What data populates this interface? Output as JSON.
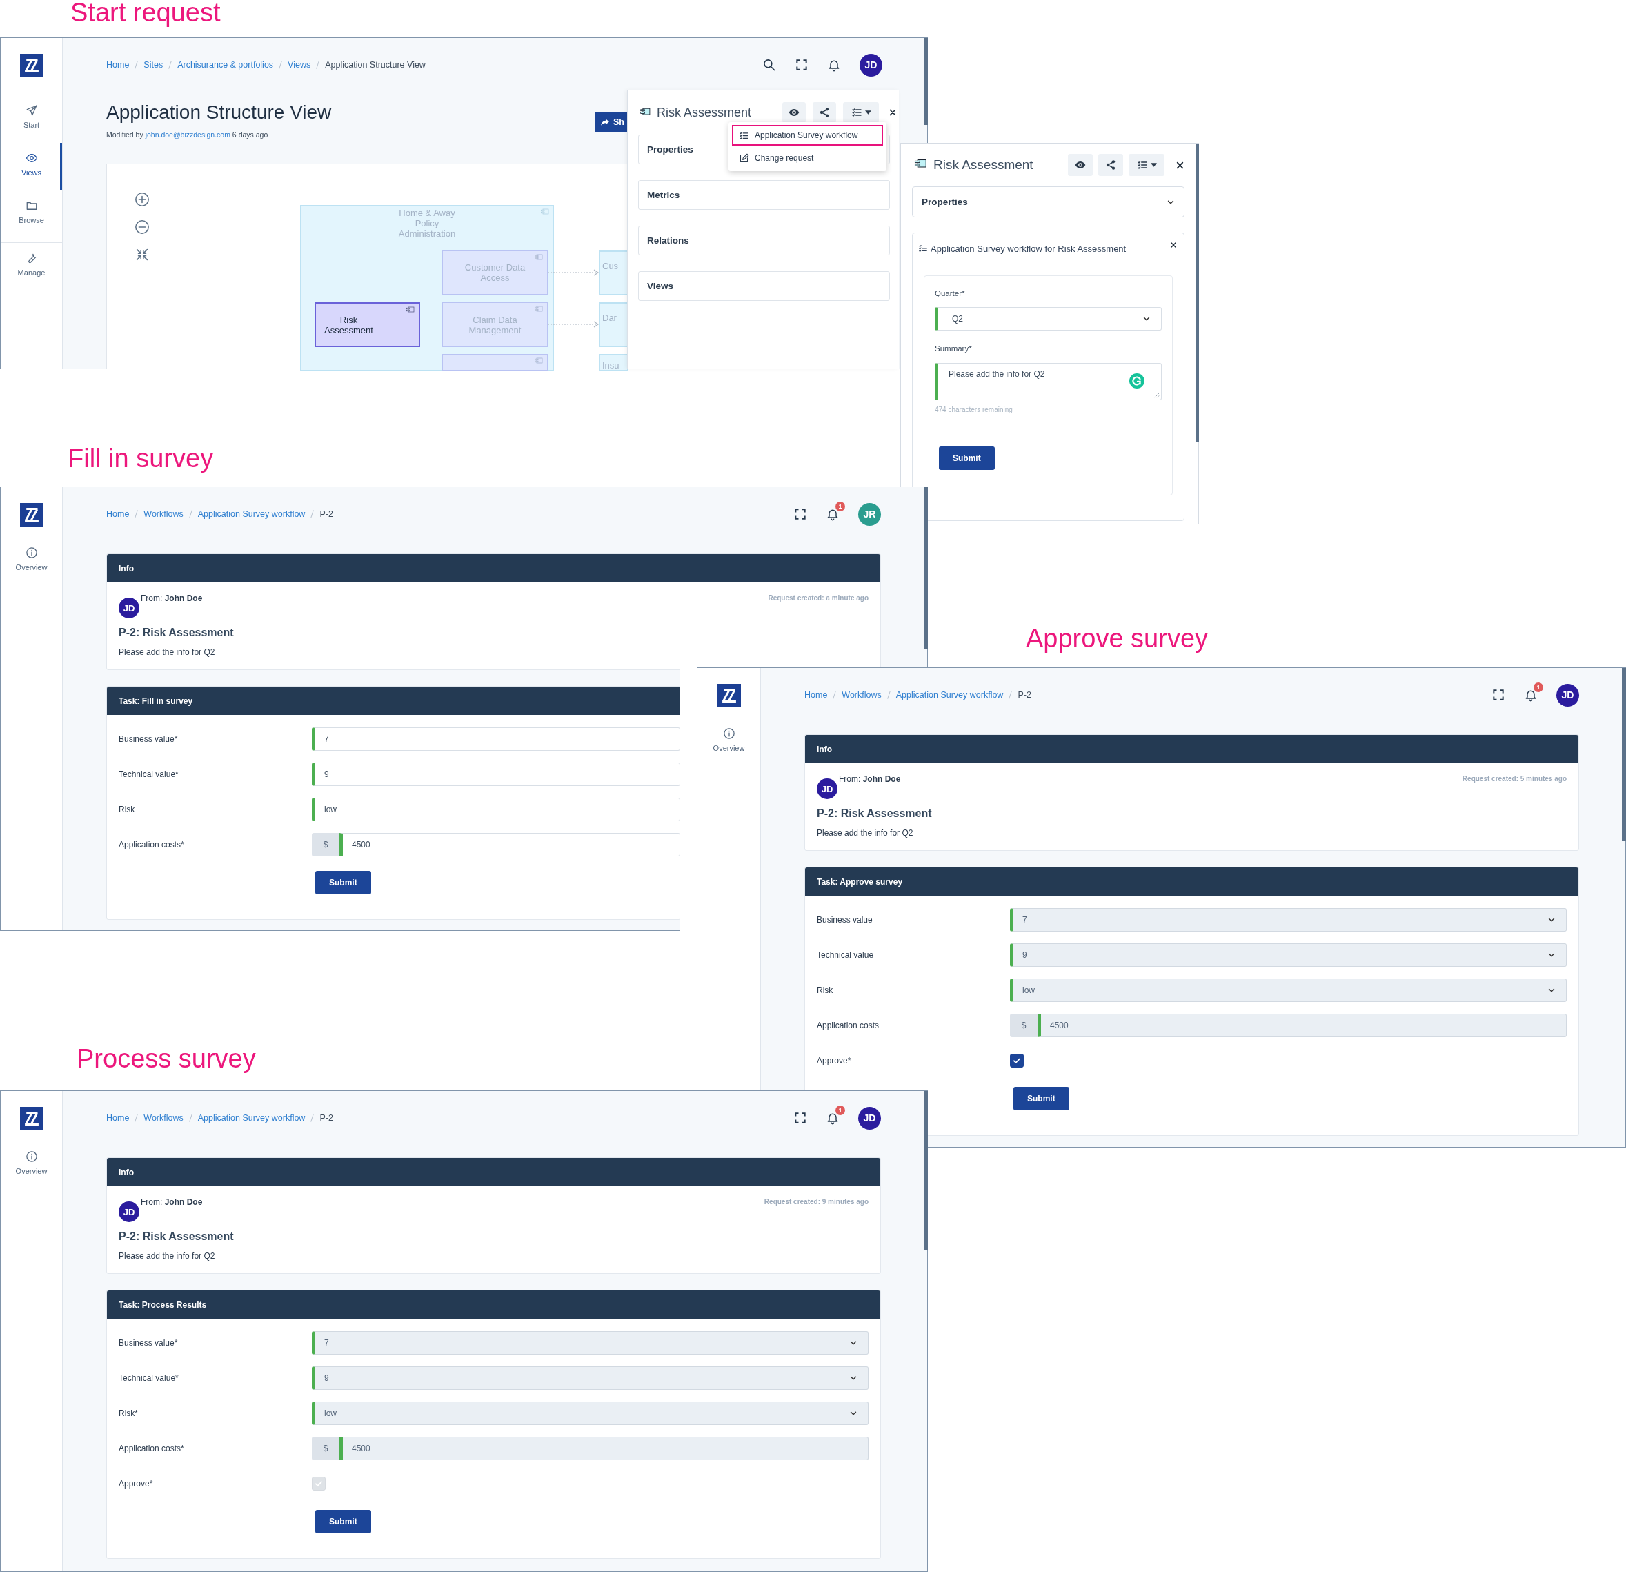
{
  "start_request": {
    "heading": "Start request",
    "sidebar": [
      {
        "label": "Start",
        "selected": false
      },
      {
        "label": "Views",
        "selected": true
      },
      {
        "label": "Browse",
        "selected": false
      },
      {
        "label": "Manage",
        "selected": false
      }
    ],
    "breadcrumb": [
      "Home",
      "Sites",
      "Archisurance & portfolios",
      "Views",
      "Application Structure View"
    ],
    "avatar": {
      "initials": "JD",
      "color": "#2b1c9e"
    },
    "title": "Application Structure View",
    "modified": {
      "prefix": "Modified by",
      "email": "john.doe@bizzdesign.com",
      "suffix": "6 days ago"
    },
    "share_button": "Sh",
    "diagram": [
      {
        "kind": "group",
        "label": "Home & Away Policy Administration",
        "selected": false
      },
      {
        "kind": "component",
        "label": "Risk Assessment",
        "selected": true
      },
      {
        "kind": "component",
        "label": "Customer Data Access",
        "selected": false
      },
      {
        "kind": "component",
        "label": "Claim Data Management",
        "selected": false
      },
      {
        "kind": "component",
        "selected": false
      },
      {
        "kind": "partial",
        "label": "Cus",
        "selected": false
      },
      {
        "kind": "partial",
        "label": "Dar",
        "selected": false
      },
      {
        "kind": "partial",
        "label": "Insu",
        "selected": false
      }
    ],
    "panel": {
      "title": "Risk Assessment",
      "menu": [
        {
          "label": "Application Survey workflow",
          "selected": true
        },
        {
          "label": "Change request",
          "selected": false
        }
      ],
      "sections": [
        "Properties",
        "Metrics",
        "Relations",
        "Views"
      ]
    }
  },
  "workflow_panel": {
    "title": "Risk Assessment",
    "section": "Properties",
    "form_title": "Application Survey workflow for Risk Assessment",
    "fields": [
      {
        "label": "Quarter*",
        "kind": "select",
        "value": "Q2"
      },
      {
        "label": "Summary*",
        "kind": "textarea",
        "value": "Please add the info for Q2",
        "hint": "474 characters remaining"
      }
    ],
    "submit": "Submit"
  },
  "screens": [
    {
      "heading": "Fill in survey",
      "sidebar_item": "Overview",
      "breadcrumb": [
        "Home",
        "Workflows",
        "Application Survey workflow",
        "P-2"
      ],
      "notifications": "1",
      "avatar": {
        "initials": "JR",
        "color": "#2a9d8f"
      },
      "info": {
        "title": "Info",
        "sender_initials": "JD",
        "from": "From: **John Doe**",
        "created": "Request created: a minute ago",
        "subject": "P-2: Risk Assessment",
        "message": "Please add the info for Q2"
      },
      "task": {
        "title": "Task: Fill in survey",
        "fields": [
          {
            "label": "Business value*",
            "kind": "input",
            "value": "7",
            "disabled": false
          },
          {
            "label": "Technical value*",
            "kind": "input",
            "value": "9",
            "disabled": false
          },
          {
            "label": "Risk",
            "kind": "input",
            "value": "low",
            "disabled": false
          },
          {
            "label": "Application costs*",
            "kind": "currency",
            "prefix": "$",
            "value": "4500",
            "disabled": false
          }
        ],
        "submit": "Submit"
      }
    },
    {
      "heading": "Approve survey",
      "sidebar_item": "Overview",
      "breadcrumb": [
        "Home",
        "Workflows",
        "Application Survey workflow",
        "P-2"
      ],
      "notifications": "1",
      "avatar": {
        "initials": "JD",
        "color": "#2b1c9e"
      },
      "info": {
        "title": "Info",
        "sender_initials": "JD",
        "from": "From: **John Doe**",
        "created": "Request created: 5 minutes ago",
        "subject": "P-2: Risk Assessment",
        "message": "Please add the info for Q2"
      },
      "task": {
        "title": "Task: Approve survey",
        "fields": [
          {
            "label": "Business value",
            "kind": "select",
            "value": "7",
            "disabled": true
          },
          {
            "label": "Technical value",
            "kind": "select",
            "value": "9",
            "disabled": true
          },
          {
            "label": "Risk",
            "kind": "select",
            "value": "low",
            "disabled": true
          },
          {
            "label": "Application costs",
            "kind": "currency",
            "prefix": "$",
            "value": "4500",
            "disabled": true
          },
          {
            "label": "Approve*",
            "kind": "checkbox",
            "checked": true,
            "disabled": false
          }
        ],
        "submit": "Submit"
      }
    },
    {
      "heading": "Process survey",
      "sidebar_item": "Overview",
      "breadcrumb": [
        "Home",
        "Workflows",
        "Application Survey workflow",
        "P-2"
      ],
      "notifications": "1",
      "avatar": {
        "initials": "JD",
        "color": "#2b1c9e"
      },
      "info": {
        "title": "Info",
        "sender_initials": "JD",
        "from": "From: **John Doe**",
        "created": "Request created: 9 minutes ago",
        "subject": "P-2: Risk Assessment",
        "message": "Please add the info for Q2"
      },
      "task": {
        "title": "Task: Process Results",
        "fields": [
          {
            "label": "Business value*",
            "kind": "select",
            "value": "7",
            "disabled": true
          },
          {
            "label": "Technical value*",
            "kind": "select",
            "value": "9",
            "disabled": true
          },
          {
            "label": "Risk*",
            "kind": "select",
            "value": "low",
            "disabled": true
          },
          {
            "label": "Application costs*",
            "kind": "currency",
            "prefix": "$",
            "value": "4500",
            "disabled": true
          },
          {
            "label": "Approve*",
            "kind": "checkbox",
            "checked": true,
            "disabled": true
          }
        ],
        "submit": "Submit"
      }
    }
  ]
}
